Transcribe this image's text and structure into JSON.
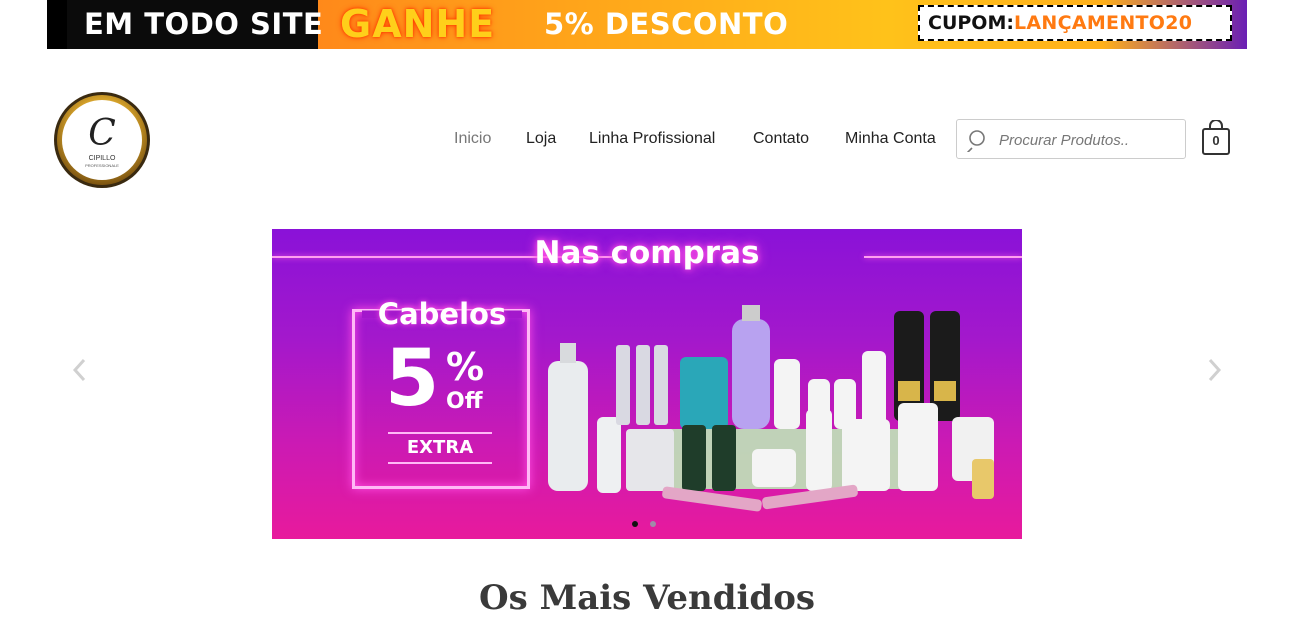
{
  "promo": {
    "left_text": "EM TODO SITE",
    "ganhe": "GANHE",
    "discount": "5% DESCONTO",
    "coupon_label": "CUPOM:",
    "coupon_code": "LANÇAMENTO20"
  },
  "logo": {
    "mark": "C",
    "brand": "CIPILLO",
    "sub": "PROFESSIONALE"
  },
  "nav": {
    "items": [
      {
        "label": "Inicio",
        "active": true
      },
      {
        "label": "Loja",
        "active": false
      },
      {
        "label": "Linha Profissional",
        "active": false
      },
      {
        "label": "Contato",
        "active": false
      },
      {
        "label": "Minha Conta",
        "active": false
      }
    ]
  },
  "search": {
    "placeholder": "Procurar Produtos.."
  },
  "cart": {
    "count": "0"
  },
  "hero": {
    "title": "Nas compras",
    "offer_category": "Cabelos",
    "offer_number": "5",
    "offer_symbol": "%",
    "offer_off": "Off",
    "offer_extra": "EXTRA",
    "slide_count": 2,
    "active_slide": 1
  },
  "sections": {
    "best_sellers_title": "Os Mais Vendidos"
  },
  "colors": {
    "accent_orange": "#ff7a12",
    "hero_purple": "#8a12d8",
    "hero_pink": "#e81a9c"
  }
}
